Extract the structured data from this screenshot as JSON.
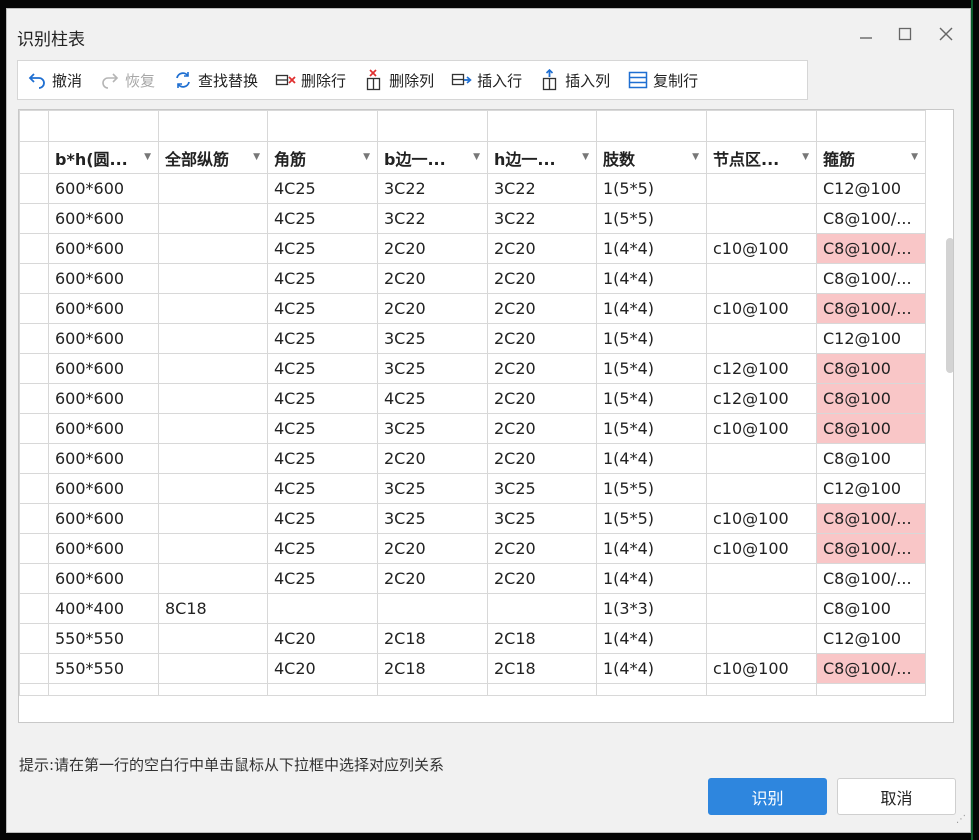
{
  "window": {
    "title": "识别柱表",
    "minimize_icon": "minimize-icon",
    "maximize_icon": "maximize-icon",
    "close_icon": "close-icon"
  },
  "toolbar": {
    "undo": "撤消",
    "redo": "恢复",
    "find_replace": "查找替换",
    "delete_row": "删除行",
    "delete_col": "删除列",
    "insert_row": "插入行",
    "insert_col": "插入列",
    "copy_row": "复制行"
  },
  "table": {
    "columns": [
      "b*h(圆...",
      "全部纵筋",
      "角筋",
      "b边一...",
      "h边一...",
      "肢数",
      "节点区...",
      "箍筋"
    ],
    "rows": [
      [
        "600*600",
        "",
        "4C25",
        "3C22",
        "3C22",
        "1(5*5)",
        "",
        "C12@100"
      ],
      [
        "600*600",
        "",
        "4C25",
        "3C22",
        "3C22",
        "1(5*5)",
        "",
        "C8@100/..."
      ],
      [
        "600*600",
        "",
        "4C25",
        "2C20",
        "2C20",
        "1(4*4)",
        "c10@100",
        "C8@100/..."
      ],
      [
        "600*600",
        "",
        "4C25",
        "2C20",
        "2C20",
        "1(4*4)",
        "",
        "C8@100/..."
      ],
      [
        "600*600",
        "",
        "4C25",
        "2C20",
        "2C20",
        "1(4*4)",
        "c10@100",
        "C8@100/..."
      ],
      [
        "600*600",
        "",
        "4C25",
        "3C25",
        "2C20",
        "1(5*4)",
        "",
        "C12@100"
      ],
      [
        "600*600",
        "",
        "4C25",
        "3C25",
        "2C20",
        "1(5*4)",
        "c12@100",
        "C8@100"
      ],
      [
        "600*600",
        "",
        "4C25",
        "4C25",
        "2C20",
        "1(5*4)",
        "c12@100",
        "C8@100"
      ],
      [
        "600*600",
        "",
        "4C25",
        "3C25",
        "2C20",
        "1(5*4)",
        "c10@100",
        "C8@100"
      ],
      [
        "600*600",
        "",
        "4C25",
        "2C20",
        "2C20",
        "1(4*4)",
        "",
        "C8@100"
      ],
      [
        "600*600",
        "",
        "4C25",
        "3C25",
        "3C25",
        "1(5*5)",
        "",
        "C12@100"
      ],
      [
        "600*600",
        "",
        "4C25",
        "3C25",
        "3C25",
        "1(5*5)",
        "c10@100",
        "C8@100/..."
      ],
      [
        "600*600",
        "",
        "4C25",
        "2C20",
        "2C20",
        "1(4*4)",
        "c10@100",
        "C8@100/..."
      ],
      [
        "600*600",
        "",
        "4C25",
        "2C20",
        "2C20",
        "1(4*4)",
        "",
        "C8@100/..."
      ],
      [
        "400*400",
        "8C18",
        "",
        "",
        "",
        "1(3*3)",
        "",
        "C8@100"
      ],
      [
        "550*550",
        "",
        "4C20",
        "2C18",
        "2C18",
        "1(4*4)",
        "",
        "C12@100"
      ],
      [
        "550*550",
        "",
        "4C20",
        "2C18",
        "2C18",
        "1(4*4)",
        "c10@100",
        "C8@100/..."
      ]
    ],
    "highlighted_rows": [
      2,
      4,
      6,
      7,
      8,
      11,
      12,
      16
    ],
    "highlight_color": "#f9c6c7"
  },
  "hint": "提示:请在第一行的空白行中单击鼠标从下拉框中选择对应列关系",
  "buttons": {
    "ok": "识别",
    "cancel": "取消"
  },
  "colors": {
    "primary_button": "#2e86de",
    "dialog_bg": "#f1f1f1"
  }
}
